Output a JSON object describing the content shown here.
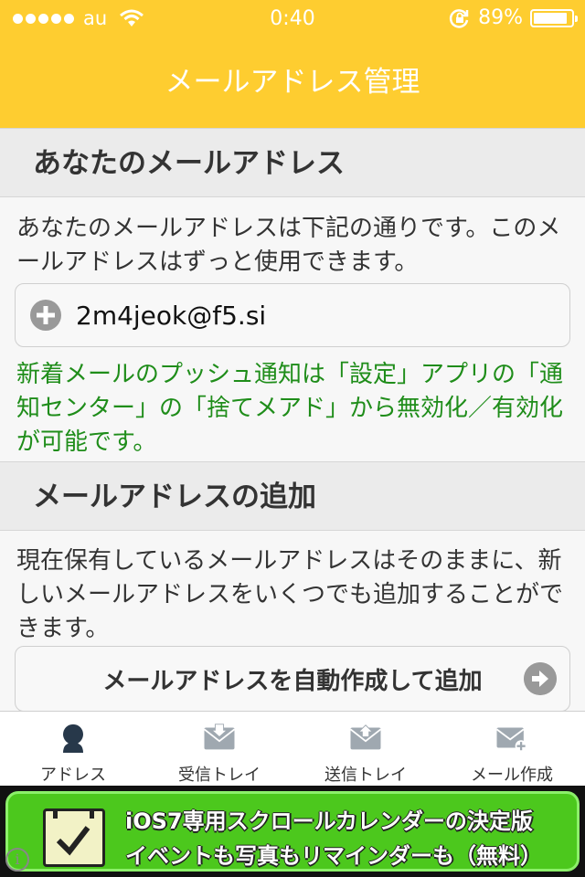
{
  "status_bar": {
    "carrier": "au",
    "time": "0:40",
    "battery": "89%",
    "battery_level": 0.89
  },
  "nav": {
    "title": "メールアドレス管理"
  },
  "section1": {
    "title": "あなたのメールアドレス",
    "description": "あなたのメールアドレスは下記の通りです。このメールアドレスはずっと使用できます。",
    "address": "2m4jeok@f5.si",
    "address_icon": "plus-circle-icon",
    "notice": "新着メールのプッシュ通知は「設定」アプリの「通知センター」の「捨てメアド」から無効化／有効化が可能です。"
  },
  "section2": {
    "title": "メールアドレスの追加",
    "description": "現在保有しているメールアドレスはそのままに、新しいメールアドレスをいくつでも追加することができます。",
    "button_label": "メールアドレスを自動作成して追加",
    "button_icon": "arrow-right-circle-icon"
  },
  "tabs": [
    {
      "label": "アドレス",
      "icon": "person-icon",
      "active": true
    },
    {
      "label": "受信トレイ",
      "icon": "inbox-icon",
      "active": false
    },
    {
      "label": "送信トレイ",
      "icon": "outbox-icon",
      "active": false
    },
    {
      "label": "メール作成",
      "icon": "compose-mail-icon",
      "active": false
    }
  ],
  "ad_banner": {
    "line1": "iOS7専用スクロールカレンダーの決定版",
    "line2": "イベントも写真もリマインダーも（無料）",
    "icon": "calendar-check-icon",
    "info_icon": "info-icon"
  },
  "colors": {
    "accent": "#fecd30",
    "notice_text": "#1f8d1a",
    "banner_bg": "#4cc81d"
  }
}
